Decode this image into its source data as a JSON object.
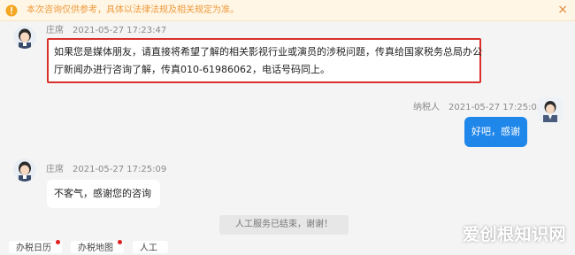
{
  "notice": {
    "text": "本次咨询仅供参考，具体以法律法规及相关规定为准。",
    "close_label": "×"
  },
  "messages": [
    {
      "sender": "庄席",
      "time": "2021-05-27 17:23:47",
      "line1": "如果您是媒体朋友，请直接将希望了解的相关影视行业或演员的涉税问题，传真给国家税务总局办公",
      "line2": "厅新闻办进行咨询了解，传真010-61986062，电话号码同上。"
    },
    {
      "sender": "纳税人",
      "time": "2021-05-27 17:25:05",
      "text": "好吧，感谢"
    },
    {
      "sender": "庄席",
      "time": "2021-05-27 17:25:09",
      "text": "不客气，感谢您的咨询"
    }
  ],
  "system_message": "人工服务已结束，谢谢！",
  "quick_actions": [
    "办税日历",
    "办税地图",
    "人工"
  ],
  "watermark": "爱创根知识网",
  "colors": {
    "user_bubble": "#1f86ea",
    "highlight_border": "#d9302b",
    "notice_text": "#ef9a3d"
  }
}
